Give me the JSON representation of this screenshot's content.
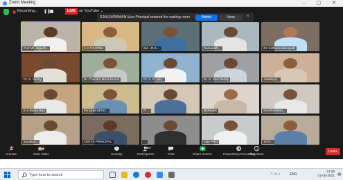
{
  "window": {
    "title": "Zoom Meeting",
    "controls": "– ▢ ✕"
  },
  "topbar": {
    "recording_label": "Recording...",
    "pause_glyph": "❚❚",
    "live_label": "LIVE",
    "youtube_label": "on YouTube ⌄"
  },
  "notification": {
    "text": "S.NUSHRAMAN,Vice-Principal entered the waiting room",
    "admit_label": "Admit",
    "view_label": "View",
    "close_glyph": "×"
  },
  "participants": [
    {
      "name": "D.Lt Mr. Jagadh...",
      "bg": "#b9b3a8",
      "skin": "#5b3b25",
      "shirt": "#f0f0f0",
      "active": true
    },
    {
      "name": "A-K.P.SARMA",
      "bg": "#d7b786",
      "skin": "#8b5e3c",
      "shirt": "#cfc7b6",
      "active": false
    },
    {
      "name": "MA...R.S....",
      "bg": "#5c6f77",
      "skin": "#7a5238",
      "shirt": "#3f6fa0",
      "active": false
    },
    {
      "name": "Ramanath...",
      "bg": "#a9b7bf",
      "skin": "#6b4a35",
      "shirt": "#e4e4e4",
      "active": false
    },
    {
      "name": "Dr. Kirthana Manepalli",
      "bg": "#7d6e63",
      "skin": "#b07a55",
      "shirt": "#bfe0f5",
      "active": false
    },
    {
      "name": "Dr. B. Sastry",
      "bg": "#7a4a2e",
      "skin": "#6b4a35",
      "shirt": "#e3dfd9",
      "active": false
    },
    {
      "name": "Dr. Chandra Mouli Kumar",
      "bg": "#9fae9a",
      "skin": "#7a5238",
      "shirt": "#c9c9c9",
      "active": false
    },
    {
      "name": "Dr. K. R. Sai...",
      "bg": "#8fb3cf",
      "skin": "#6b4a35",
      "shirt": "#f2f2f2",
      "active": false
    },
    {
      "name": "Dr. N. Sasi Reddy",
      "bg": "#a09fa2",
      "skin": "#6b4a35",
      "shirt": "#cdd3da",
      "active": false
    },
    {
      "name": "Alaekhya...",
      "bg": "#cdb09a",
      "skin": "#8b5e3c",
      "shirt": "#d8c7b4",
      "active": false
    },
    {
      "name": "K.A.Rama Rao",
      "bg": "#c4a57e",
      "skin": "#6b4a35",
      "shirt": "#e8e8e8",
      "active": false
    },
    {
      "name": "Principal DEVO...",
      "bg": "#cbbb8e",
      "skin": "#7a5238",
      "shirt": "#6b8fb3",
      "active": false
    },
    {
      "name": "P. ...",
      "bg": "#d4c7b5",
      "skin": "#6b4a35",
      "shirt": "#4d6f9a",
      "active": false
    },
    {
      "name": "MDNotes",
      "bg": "#ddd5cb",
      "skin": "#9c6c4a",
      "shirt": "#c7b9a8",
      "active": false
    },
    {
      "name": "Ka KRISHNA...",
      "bg": "#cfc9c1",
      "skin": "#7a5238",
      "shirt": "#e8e8e8",
      "active": false
    },
    {
      "name": "sumalpu...",
      "bg": "#b7a188",
      "skin": "#6b4a35",
      "shirt": "#ececec",
      "active": false
    },
    {
      "name": "ADITYA PRINCIPAL",
      "bg": "#7a6c5f",
      "skin": "#5b3b25",
      "shirt": "#3d4e68",
      "active": false
    },
    {
      "name": "...",
      "bg": "#8d8d8d",
      "skin": "#6b4a35",
      "shirt": "#2f2f2f",
      "active": false
    },
    {
      "name": "Ajay PRO",
      "bg": "#c8cbcc",
      "skin": "#7a5238",
      "shirt": "#f0f0f0",
      "active": false
    },
    {
      "name": "Sri D...",
      "bg": "#b9ab9a",
      "skin": "#8b5e3c",
      "shirt": "#5b7fa8",
      "active": false
    }
  ],
  "toolbar": {
    "items": [
      {
        "label": "Unmute",
        "icon": "mic-muted-icon"
      },
      {
        "label": "Start Video",
        "icon": "video-off-icon"
      },
      {
        "label": "Security",
        "icon": "shield-icon"
      },
      {
        "label": "Participants",
        "icon": "participants-icon",
        "count": "159"
      },
      {
        "label": "Chat",
        "icon": "chat-icon"
      },
      {
        "label": "Share Screen",
        "icon": "share-screen-icon"
      },
      {
        "label": "Pause/Stop Recording",
        "icon": "pause-record-icon"
      },
      {
        "label": "Reactions",
        "icon": "reactions-icon"
      }
    ],
    "leave_label": "Leave",
    "accent": "#23c552",
    "record_accent": "#e02828"
  },
  "taskbar": {
    "search_placeholder": "Type here to search",
    "lang": "ENG",
    "time": "14:29",
    "date": "01-06-2021"
  }
}
